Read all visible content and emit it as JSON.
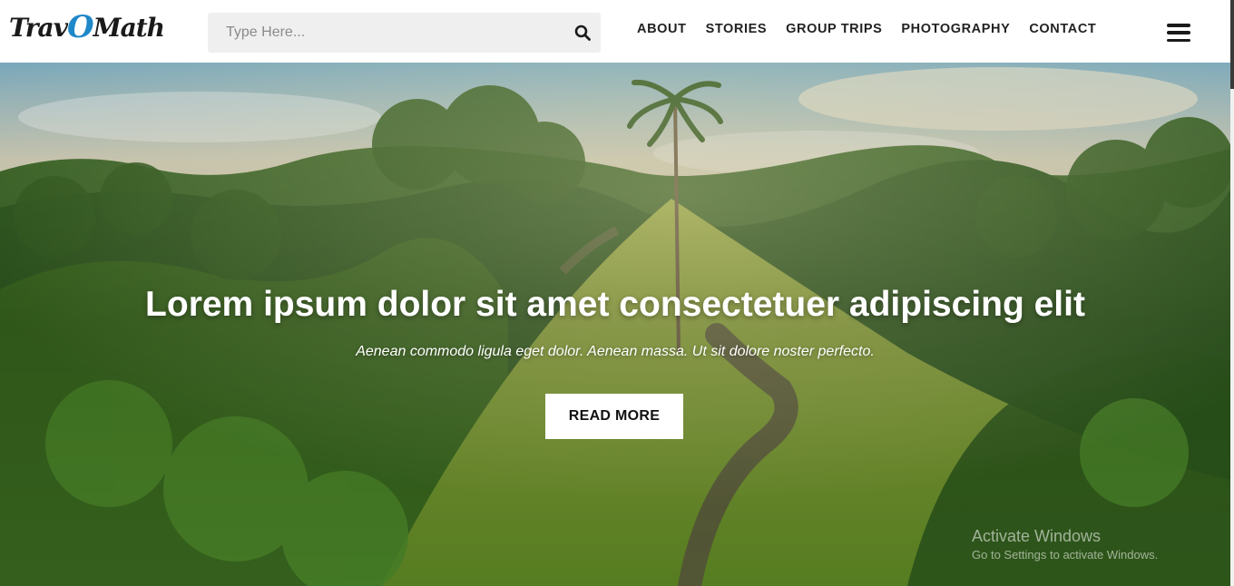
{
  "header": {
    "logo_text_a": "Trav",
    "logo_text_o": "O",
    "logo_text_b": "Math",
    "search_placeholder": "Type Here...",
    "search_icon": "search-icon",
    "menu_icon": "hamburger-icon"
  },
  "nav": {
    "items": [
      {
        "label": "ABOUT"
      },
      {
        "label": "STORIES"
      },
      {
        "label": "GROUP TRIPS"
      },
      {
        "label": "PHOTOGRAPHY"
      },
      {
        "label": "CONTACT"
      }
    ]
  },
  "hero": {
    "title": "Lorem ipsum dolor sit amet consectetuer adipiscing elit",
    "subtitle": "Aenean commodo ligula eget dolor. Aenean massa. Ut sit dolore noster perfecto.",
    "cta_label": "READ MORE"
  },
  "watermark": {
    "line1": "Activate Windows",
    "line2": "Go to Settings to activate Windows."
  },
  "colors": {
    "logo_accent": "#1e88c8",
    "search_bg": "#efefef",
    "nav_text": "#222222"
  }
}
